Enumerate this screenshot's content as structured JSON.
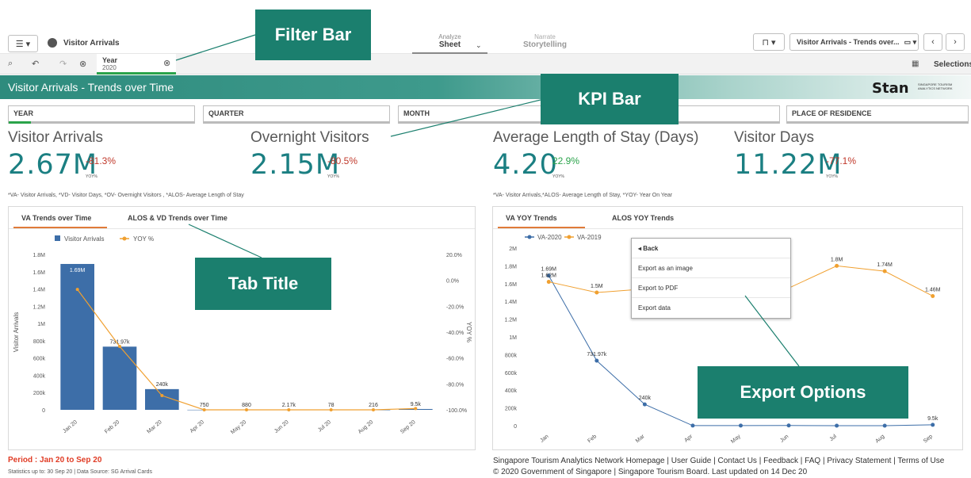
{
  "topbar": {
    "menu_icon": "☰ ▾",
    "app_title": "Visitor Arrivals",
    "analyze_label": "Analyze",
    "sheet_label": "Sheet",
    "narrate_label": "Narrate",
    "storytelling_label": "Storytelling",
    "sheet_selector": "Visitor Arrivals - Trends over...",
    "selections_label": "Selections"
  },
  "filter": {
    "field": "Year",
    "value": "2020"
  },
  "banner": {
    "title": "Visitor Arrivals - Trends over Time",
    "logo_text": "Stan",
    "logo_sub1": "SINGAPORE TOURISM",
    "logo_sub2": "ANALYTICS NETWORK"
  },
  "filters": [
    {
      "label": "YEAR",
      "fill": 0.12
    },
    {
      "label": "QUARTER",
      "fill": 0
    },
    {
      "label": "MONTH",
      "fill": 0
    },
    {
      "label": "",
      "fill": 0
    },
    {
      "label": "PLACE OF RESIDENCE",
      "fill": 0
    }
  ],
  "kpis": [
    {
      "title": "Visitor Arrivals",
      "value": "2.67M",
      "change": "-81.3%",
      "yoy": "YOY%",
      "color": "#c0392b"
    },
    {
      "title": "Overnight Visitors",
      "value": "2.15M",
      "change": "-80.5%",
      "yoy": "YOY%",
      "color": "#c0392b"
    },
    {
      "title": "Average Length of Stay (Days)",
      "value": "4.20",
      "change": "22.9%",
      "yoy": "YOY%",
      "color": "#2aa34a"
    },
    {
      "title": "Visitor Days",
      "value": "11.22M",
      "change": "-77.1%",
      "yoy": "YOY%",
      "color": "#c0392b"
    }
  ],
  "notes": {
    "left": "*VA- Visitor Arrivals, *VD- Visitor Days, *OV- Overnight Visitors , *ALOS- Average Length of Stay",
    "right": "*VA- Visitor Arrivals,*ALOS- Average Length of Stay, *YOY- Year On Year"
  },
  "tabs_left": [
    "VA Trends over Time",
    "ALOS & VD Trends over Time"
  ],
  "tabs_right": [
    "VA YOY Trends",
    "ALOS YOY Trends"
  ],
  "context_menu": [
    "◂  Back",
    "Export as an image",
    "Export to PDF",
    "Export data"
  ],
  "callouts": {
    "filter_bar": "Filter Bar",
    "kpi_bar": "KPI Bar",
    "tab_title": "Tab Title",
    "export_options": "Export Options"
  },
  "footer": {
    "period": "Period : Jan 20 to Sep 20",
    "stats": "Statistics up to: 30 Sep 20 | Data Source: SG Arrival Cards",
    "links": "Singapore Tourism Analytics Network Homepage | User Guide | Contact Us | Feedback | FAQ | Privacy Statement | Terms of Use",
    "copyright": "© 2020 Government of Singapore | Singapore Tourism Board. Last updated on 14 Dec 20"
  },
  "chart_data": [
    {
      "type": "bar",
      "categories": [
        "Jan 20",
        "Feb 20",
        "Mar 20",
        "Apr 20",
        "May 20",
        "Jun 20",
        "Jul 20",
        "Aug 20",
        "Sep 20"
      ],
      "series": [
        {
          "name": "Visitor Arrivals",
          "values": [
            1690000,
            731970,
            240000,
            750,
            880,
            2170,
            78,
            216,
            9500
          ],
          "labels": [
            "1.69M",
            "731.97k",
            "240k",
            "750",
            "880",
            "2.17k",
            "78",
            "216",
            "9.5k"
          ],
          "color": "#3d6ea8"
        },
        {
          "name": "YOY %",
          "values": [
            -7,
            -51,
            -89,
            -100,
            -100,
            -100,
            -100,
            -100,
            -99
          ],
          "color": "#f0a030",
          "axis": "right"
        }
      ],
      "ylabel": "Visitor Arrivals",
      "y2label": "YOY %",
      "yticks": [
        "0",
        "200k",
        "400k",
        "600k",
        "800k",
        "1M",
        "1.2M",
        "1.4M",
        "1.6M",
        "1.8M"
      ],
      "y2ticks": [
        "-100.0%",
        "-80.0%",
        "-60.0%",
        "-40.0%",
        "-20.0%",
        "0.0%",
        "20.0%"
      ],
      "ylim": [
        0,
        1800000
      ],
      "y2lim": [
        -100,
        20
      ]
    },
    {
      "type": "line",
      "categories": [
        "Jan",
        "Feb",
        "Mar",
        "Apr",
        "May",
        "Jun",
        "Jul",
        "Aug",
        "Sep"
      ],
      "series": [
        {
          "name": "VA-2020",
          "values": [
            1690000,
            731970,
            240000,
            750,
            880,
            2170,
            78,
            216,
            9500
          ],
          "labels": [
            "1.69M",
            "731.97k",
            "240k",
            "",
            "",
            "",
            "",
            "",
            "9.5k"
          ],
          "color": "#3d6ea8"
        },
        {
          "name": "VA-2019",
          "values": [
            1620000,
            1500000,
            1540000,
            1600000,
            1580000,
            1550000,
            1800000,
            1740000,
            1460000
          ],
          "labels": [
            "1.62M",
            "1.5M",
            "",
            "",
            "",
            "",
            "1.8M",
            "1.74M",
            "1.46M"
          ],
          "color": "#f0a030"
        }
      ],
      "yticks": [
        "0",
        "200k",
        "400k",
        "600k",
        "800k",
        "1M",
        "1.2M",
        "1.4M",
        "1.6M",
        "1.8M",
        "2M"
      ],
      "ylim": [
        0,
        2000000
      ]
    }
  ]
}
